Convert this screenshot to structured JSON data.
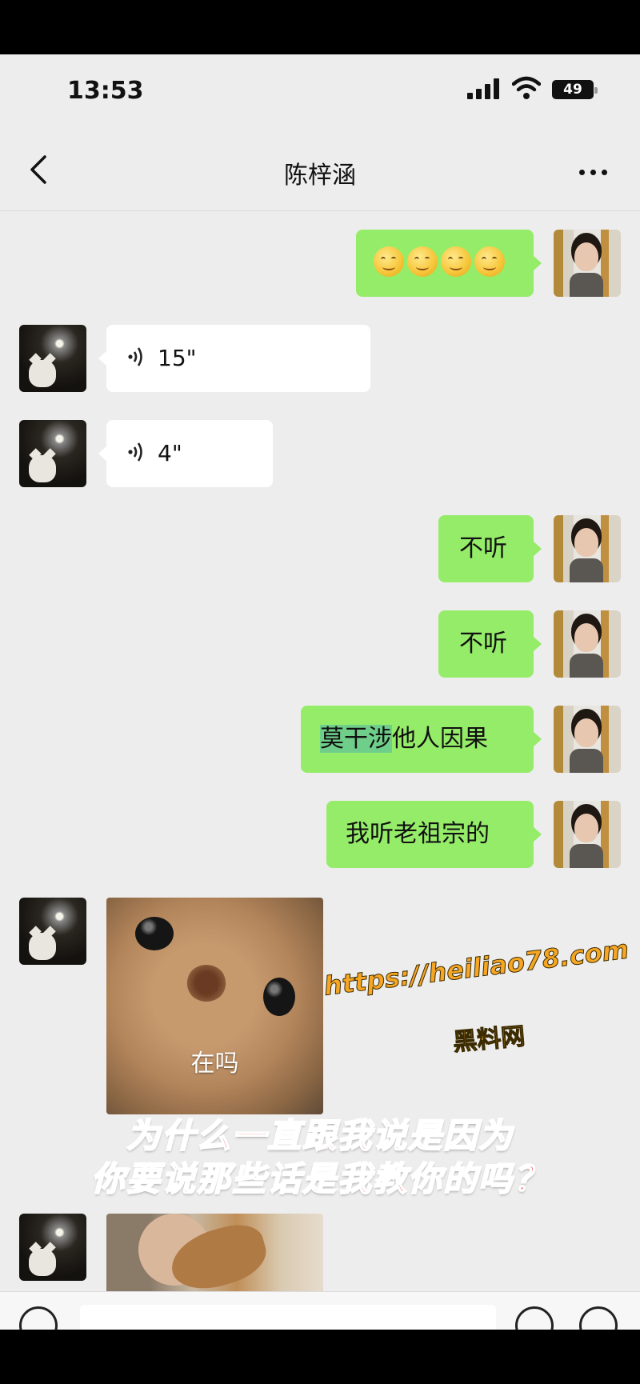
{
  "status_bar": {
    "time": "13:53",
    "battery": "49"
  },
  "header": {
    "contact_name": "陈梓涵"
  },
  "messages": [
    {
      "sender": "me",
      "type": "emoji",
      "emoji_count": 4
    },
    {
      "sender": "them",
      "type": "voice",
      "duration": "15\""
    },
    {
      "sender": "them",
      "type": "voice",
      "duration": "4\""
    },
    {
      "sender": "me",
      "type": "text",
      "text": "不听"
    },
    {
      "sender": "me",
      "type": "text",
      "text": "不听"
    },
    {
      "sender": "me",
      "type": "text",
      "highlight": "莫干涉",
      "text": "他人因果"
    },
    {
      "sender": "me",
      "type": "text",
      "text": "我听老祖宗的"
    },
    {
      "sender": "them",
      "type": "sticker",
      "caption": "在吗"
    },
    {
      "sender": "them",
      "type": "sticker",
      "caption": ""
    }
  ],
  "overlay": {
    "watermark_url": "https://heiliao78.com",
    "watermark_site": "黑料网",
    "caption_line1": "为什么一直跟我说是因为",
    "caption_line2": "你要说那些话是我教你的吗？"
  },
  "colors": {
    "my_bubble": "#95ec69",
    "their_bubble": "#ffffff",
    "background": "#ededed",
    "caption": "#e8555a",
    "watermark": "#f6a623"
  }
}
